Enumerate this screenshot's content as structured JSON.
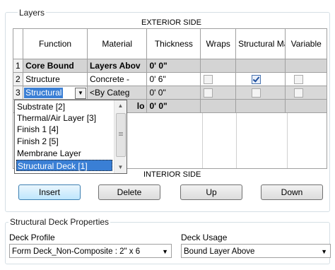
{
  "layers_group": {
    "legend": "Layers",
    "exterior_label": "EXTERIOR SIDE",
    "interior_label": "INTERIOR SIDE",
    "columns": [
      "",
      "Function",
      "Material",
      "Thickness",
      "Wraps",
      "Structural Material",
      "Variable"
    ],
    "rows": [
      {
        "num": "1",
        "function": "Core Bound",
        "material": "Layers Abov",
        "thickness": "0'  0\""
      },
      {
        "num": "2",
        "function": "Structure",
        "material": "Concrete -",
        "thickness": "0'  6\""
      },
      {
        "num": "3",
        "function": "Structural",
        "material": "<By Categ",
        "thickness": "0'  0\""
      },
      {
        "num": "4",
        "function": "",
        "material": "lo",
        "thickness": "0'  0\""
      }
    ],
    "dropdown_options": [
      "Substrate [2]",
      "Thermal/Air Layer [3]",
      "Finish 1 [4]",
      "Finish 2 [5]",
      "Membrane Layer",
      "Structural Deck [1]"
    ],
    "dropdown_selected": "Structural Deck [1]"
  },
  "buttons": {
    "insert": "Insert",
    "delete": "Delete",
    "up": "Up",
    "down": "Down"
  },
  "deck_group": {
    "legend": "Structural Deck Properties",
    "profile_label": "Deck Profile",
    "profile_value": "Form Deck_Non-Composite : 2\" x 6",
    "usage_label": "Deck Usage",
    "usage_value": "Bound Layer Above"
  },
  "icons": {
    "combo_arrow": "chevron-down-icon",
    "scroll_up": "scroll-up-icon",
    "scroll_down": "scroll-down-icon"
  }
}
